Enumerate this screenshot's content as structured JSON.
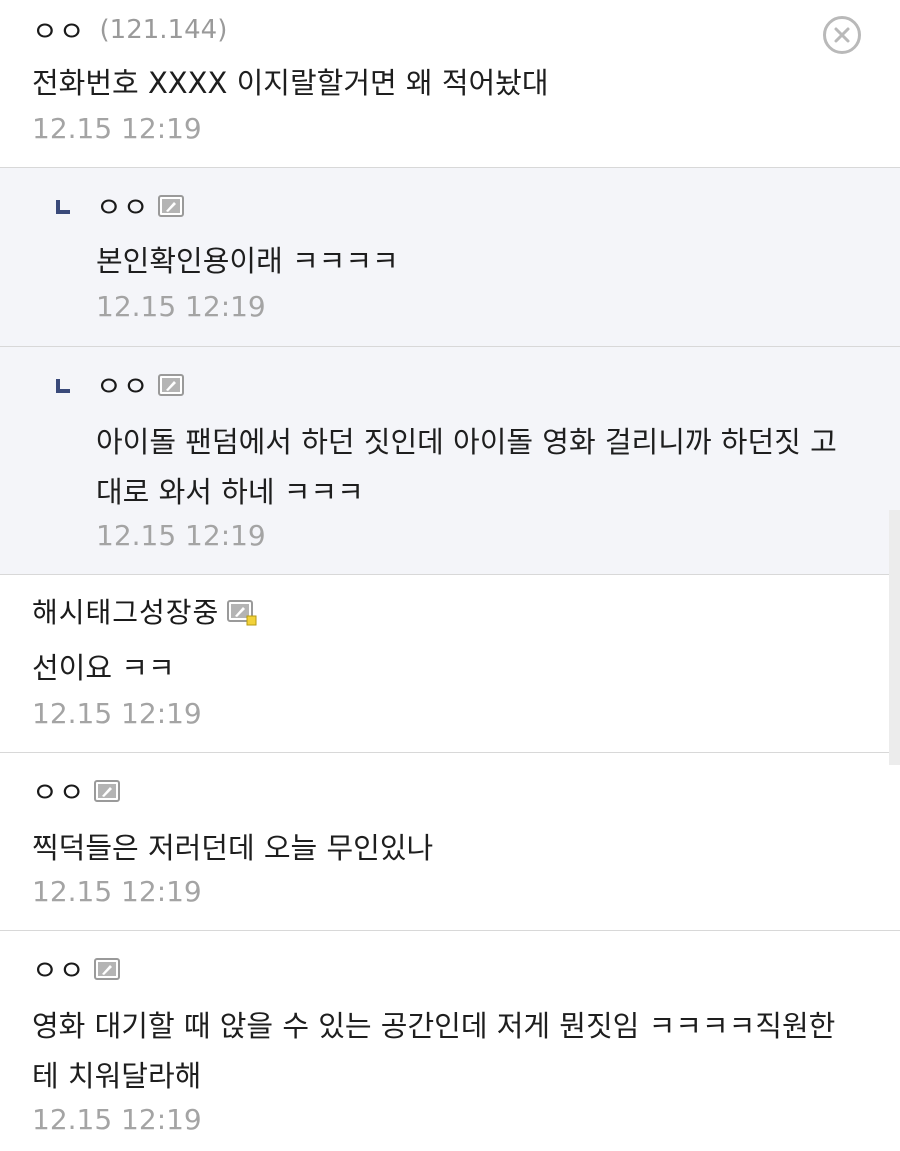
{
  "close_icon": "close-circle-icon",
  "comments": [
    {
      "nick": "ㅇㅇ",
      "ip": "(121.144)",
      "text": "전화번호 XXXX 이지랄할거면 왜 적어놨대",
      "time": "12.15 12:19"
    },
    {
      "nick": "ㅇㅇ",
      "text": "본인확인용이래 ㅋㅋㅋㅋ",
      "time": "12.15 12:19"
    },
    {
      "nick": "ㅇㅇ",
      "text": "아이돌 팬덤에서 하던 짓인데 아이돌 영화 걸리니까 하던짓 고\n대로 와서 하네 ㅋㅋㅋ",
      "time": "12.15 12:19"
    },
    {
      "nick": "해시태그성장중",
      "text": "선이요 ㅋㅋ",
      "time": "12.15 12:19"
    },
    {
      "nick": "ㅇㅇ",
      "text": "찍덕들은 저러던데 오늘 무인있나",
      "time": "12.15 12:19"
    },
    {
      "nick": "ㅇㅇ",
      "text": "영화 대기할 때 앉을 수 있는 공간인데 저게 뭔짓임 ㅋㅋㅋㅋ직원한\n테 치워달라해",
      "time": "12.15 12:19"
    }
  ]
}
